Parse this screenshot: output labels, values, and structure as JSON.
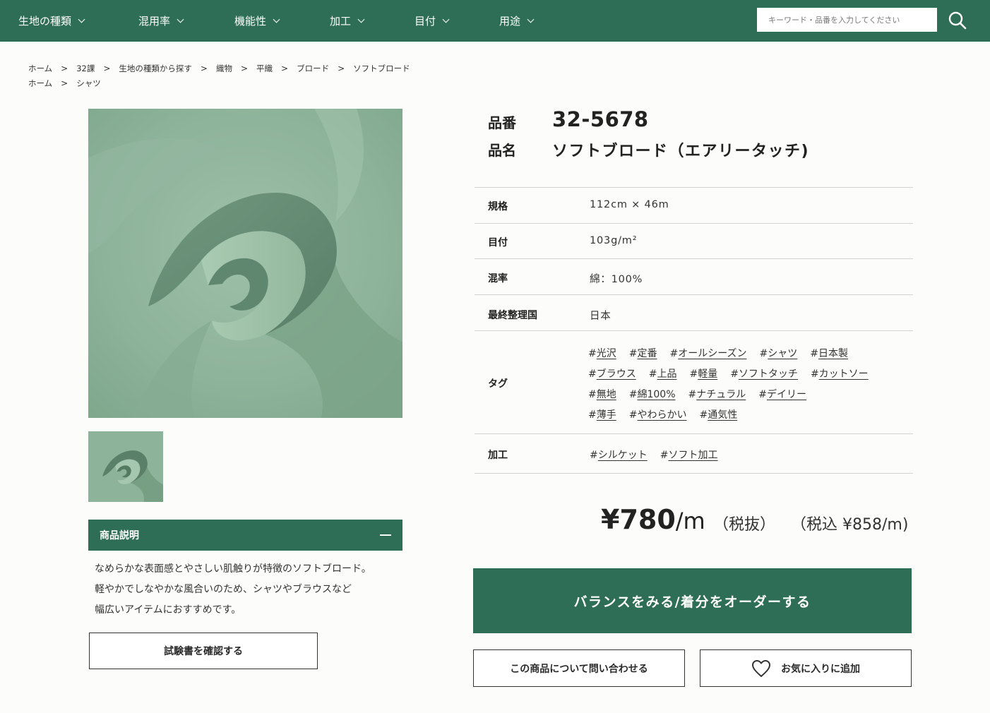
{
  "nav": {
    "items": [
      {
        "label": "生地の種類"
      },
      {
        "label": "混用率"
      },
      {
        "label": "機能性"
      },
      {
        "label": "加工"
      },
      {
        "label": "目付"
      },
      {
        "label": "用途"
      }
    ],
    "search_placeholder": "キーワード・品番を入力してください"
  },
  "breadcrumbs": {
    "row1": [
      "ホーム",
      "32課",
      "生地の種類から探す",
      "織物",
      "平織",
      "ブロード",
      "ソフトブロード"
    ],
    "row2": [
      "ホーム",
      "シャツ"
    ],
    "separator": ">"
  },
  "product": {
    "code_label": "品番",
    "code": "32-5678",
    "name_label": "品名",
    "name": "ソフトブロード（エアリータッチ)"
  },
  "specs": {
    "size_label": "規格",
    "size": "112cm × 46m",
    "weight_label": "目付",
    "weight": "103g/m²",
    "blend_label": "混率",
    "blend": "綿：100%",
    "origin_label": "最終整理国",
    "origin": "日本",
    "tags_label": "タグ",
    "tags": [
      [
        "光沢",
        "定番",
        "オールシーズン",
        "シャツ",
        "日本製"
      ],
      [
        "ブラウス",
        "上品",
        "軽量",
        "ソフトタッチ",
        "カットソー"
      ],
      [
        "無地",
        "綿100%",
        "ナチュラル",
        "デイリー"
      ],
      [
        "薄手",
        "やわらかい",
        "通気性"
      ]
    ],
    "finish_label": "加工",
    "finish": [
      "シルケット",
      "ソフト加工"
    ]
  },
  "price": {
    "main": "¥780",
    "unit": "/m",
    "tax_excluded": "（税抜）",
    "tax_included": "（税込 ¥858/m)"
  },
  "description": {
    "heading": "商品説明",
    "lines": [
      "なめらかな表面感とやさしい肌触りが特徴のソフトブロード。",
      "軽やかでしなやかな風合いのため、シャツやブラウスなど",
      "幅広いアイテムにおすすめです。"
    ],
    "test_button": "試験書を確認する"
  },
  "actions": {
    "order_button": "バランスをみる/着分をオーダーする",
    "inquiry_button": "この商品について問い合わせる",
    "favorite_button": "お気に入りに追加"
  },
  "colors": {
    "brand_green": "#2f6e56",
    "fabric_green": "#8fb39b"
  },
  "icons": {
    "search": "search-icon",
    "chevron": "chevron-down-icon",
    "heart": "heart-icon",
    "collapse": "minus-icon"
  }
}
